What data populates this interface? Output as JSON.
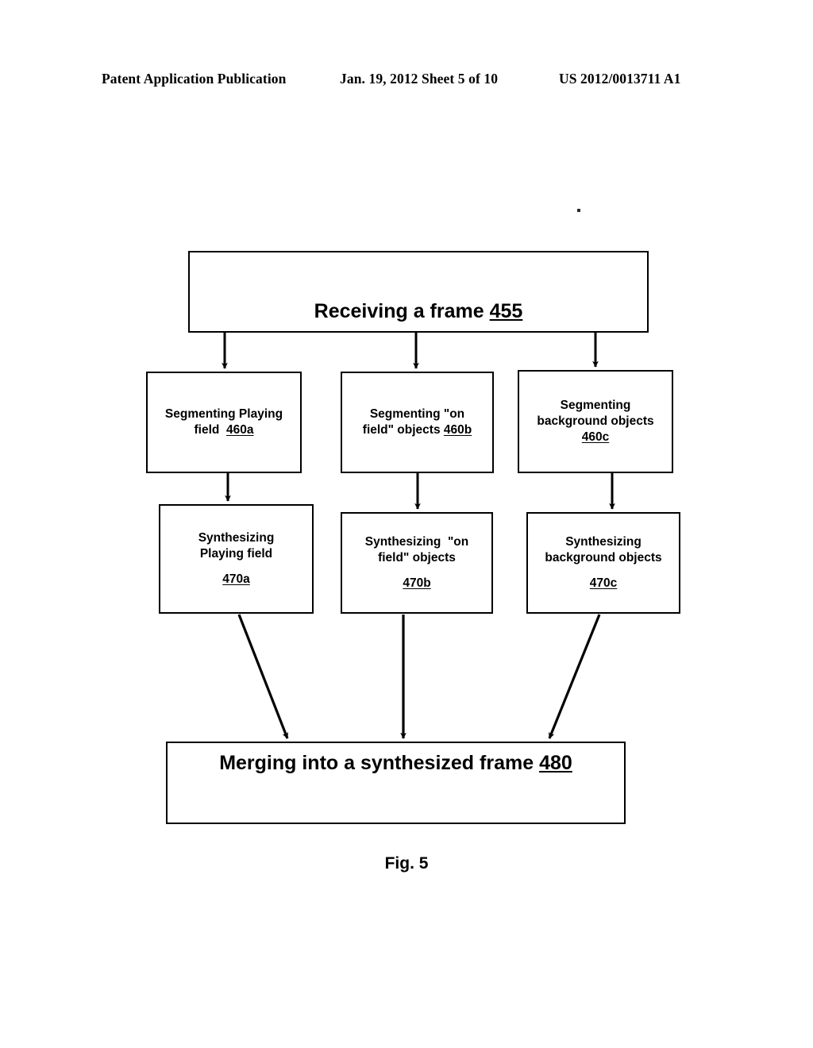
{
  "header": {
    "left": "Patent Application Publication",
    "middle": "Jan. 19, 2012  Sheet 5 of 10",
    "right": "US 2012/0013711 A1"
  },
  "figure": {
    "caption": "Fig. 5",
    "nodes": {
      "receiving": {
        "text": "Receiving a frame",
        "ref": "455",
        "full": "Receiving a frame 455"
      },
      "segmenting_playing_field": {
        "line1": "Segmenting Playing",
        "line2": "field ",
        "ref": "460a",
        "full": "Segmenting Playing field  460a"
      },
      "segmenting_on_field_objects": {
        "line1": "Segmenting \"on",
        "line2": "field\" objects ",
        "ref": "460b",
        "full": "Segmenting \"on field\" objects 460b"
      },
      "segmenting_background_objects": {
        "line1": "Segmenting",
        "line2": "background objects",
        "ref": "460c",
        "full": "Segmenting background objects 460c"
      },
      "synthesizing_playing_field": {
        "line1": "Synthesizing",
        "line2": "Playing field",
        "ref": "470a",
        "full": "Synthesizing Playing field 470a"
      },
      "synthesizing_on_field_objects": {
        "line1": "Synthesizing  \"on",
        "line2": "field\" objects",
        "ref": "470b",
        "full": "Synthesizing \"on field\" objects 470b"
      },
      "synthesizing_background_objects": {
        "line1": "Synthesizing",
        "line2": "background objects",
        "ref": "470c",
        "full": "Synthesizing background objects 470c"
      },
      "merging": {
        "text": "Merging into a synthesized frame",
        "ref": "480",
        "full": "Merging into a synthesized frame 480"
      }
    },
    "colors": {
      "stroke": "#000000",
      "fill": "#ffffff",
      "text": "#000000"
    }
  }
}
